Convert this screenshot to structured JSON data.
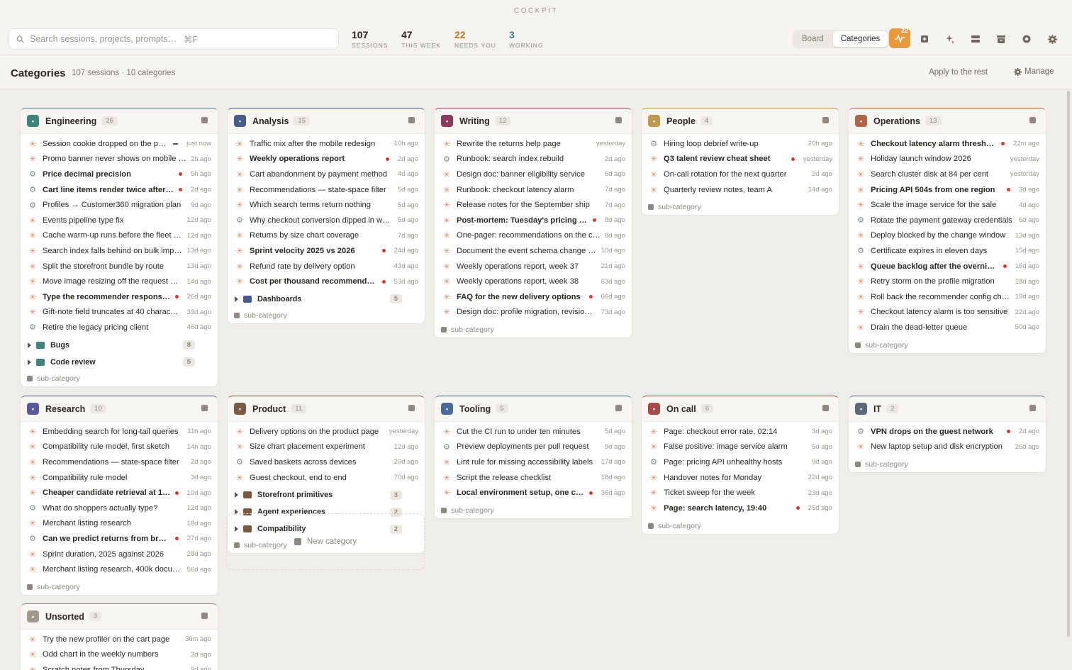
{
  "app": {
    "name": "COCKPIT"
  },
  "search": {
    "placeholder": "Search sessions, projects, prompts…",
    "shortcut": "⌘F"
  },
  "stats": [
    {
      "value": "107",
      "label": "SESSIONS",
      "color": "#2a2723"
    },
    {
      "value": "47",
      "label": "THIS WEEK",
      "color": "#2a2723"
    },
    {
      "value": "22",
      "label": "NEEDS YOU",
      "color": "#b8792a"
    },
    {
      "value": "3",
      "label": "WORKING",
      "color": "#3f7a7a"
    }
  ],
  "view_toggle": {
    "board": "Board",
    "categories": "Categories",
    "active": "categories"
  },
  "activity_badge": "22",
  "header": {
    "title": "Categories",
    "summary": "107 sessions · 10 categories",
    "apply": "Apply to the rest",
    "manage": "Manage"
  },
  "add_subcategory": "sub-category",
  "new_category": "New category",
  "categories": [
    {
      "name": "Engineering",
      "count": "26",
      "accent": "#3f7a7a",
      "icon_color": "#3f8577",
      "items": [
        {
          "title": "Session cookie dropped on the pa…",
          "time": "just now",
          "bold": false,
          "dot": false,
          "working": true,
          "icon": "spark"
        },
        {
          "title": "Promo banner never shows on mobile …",
          "time": "2h ago",
          "bold": false,
          "dot": false,
          "icon": "spark"
        },
        {
          "title": "Price decimal precision",
          "time": "5h ago",
          "bold": true,
          "dot": true,
          "icon": "gear"
        },
        {
          "title": "Cart line items render twice after r…",
          "time": "2d ago",
          "bold": true,
          "dot": true,
          "icon": "gear"
        },
        {
          "title": "Profiles → Customer360 migration plan",
          "time": "9d ago",
          "bold": false,
          "dot": false,
          "icon": "gear"
        },
        {
          "title": "Events pipeline type fix",
          "time": "12d ago",
          "bold": false,
          "dot": false,
          "icon": "spark"
        },
        {
          "title": "Cache warm-up runs before the fleet …",
          "time": "12d ago",
          "bold": false,
          "dot": false,
          "icon": "spark"
        },
        {
          "title": "Search index falls behind on bulk imp…",
          "time": "13d ago",
          "bold": false,
          "dot": false,
          "icon": "spark"
        },
        {
          "title": "Split the storefront bundle by route",
          "time": "13d ago",
          "bold": false,
          "dot": false,
          "icon": "spark"
        },
        {
          "title": "Move image resizing off the request …",
          "time": "14d ago",
          "bold": false,
          "dot": false,
          "icon": "spark"
        },
        {
          "title": "Type the recommender response …",
          "time": "26d ago",
          "bold": true,
          "dot": true,
          "icon": "spark"
        },
        {
          "title": "Gift-note field truncates at 40 charac…",
          "time": "33d ago",
          "bold": false,
          "dot": false,
          "icon": "spark"
        },
        {
          "title": "Retire the legacy pricing client",
          "time": "46d ago",
          "bold": false,
          "dot": false,
          "icon": "gear"
        }
      ],
      "subs": [
        {
          "name": "Bugs",
          "count": "8",
          "color": "#3f8577"
        },
        {
          "name": "Code review",
          "count": "5",
          "color": "#3f8577"
        }
      ]
    },
    {
      "name": "Analysis",
      "count": "15",
      "accent": "#3b4a7a",
      "icon_color": "#4a5a8a",
      "items": [
        {
          "title": "Traffic mix after the mobile redesign",
          "time": "10h ago",
          "bold": false,
          "dot": false,
          "icon": "spark"
        },
        {
          "title": "Weekly operations report",
          "time": "2d ago",
          "bold": true,
          "dot": true,
          "icon": "spark"
        },
        {
          "title": "Cart abandonment by payment method",
          "time": "4d ago",
          "bold": false,
          "dot": false,
          "icon": "spark"
        },
        {
          "title": "Recommendations — state-space filter",
          "time": "5d ago",
          "bold": false,
          "dot": false,
          "icon": "spark"
        },
        {
          "title": "Which search terms return nothing",
          "time": "5d ago",
          "bold": false,
          "dot": false,
          "icon": "spark"
        },
        {
          "title": "Why checkout conversion dipped in w…",
          "time": "5d ago",
          "bold": false,
          "dot": false,
          "icon": "gear"
        },
        {
          "title": "Returns by size chart coverage",
          "time": "7d ago",
          "bold": false,
          "dot": false,
          "icon": "spark"
        },
        {
          "title": "Sprint velocity 2025 vs 2026",
          "time": "24d ago",
          "bold": true,
          "dot": true,
          "icon": "spark"
        },
        {
          "title": "Refund rate by delivery option",
          "time": "43d ago",
          "bold": false,
          "dot": false,
          "icon": "spark"
        },
        {
          "title": "Cost per thousand recommendati…",
          "time": "53d ago",
          "bold": true,
          "dot": true,
          "icon": "spark"
        }
      ],
      "subs": [
        {
          "name": "Dashboards",
          "count": "5",
          "color": "#4a5a8a"
        }
      ]
    },
    {
      "name": "Writing",
      "count": "12",
      "accent": "#8a3a5a",
      "icon_color": "#8a3a5a",
      "items": [
        {
          "title": "Rewrite the returns help page",
          "time": "yesterday",
          "bold": false,
          "dot": false,
          "icon": "spark"
        },
        {
          "title": "Runbook: search index rebuild",
          "time": "2d ago",
          "bold": false,
          "dot": false,
          "icon": "gear"
        },
        {
          "title": "Design doc: banner eligibility service",
          "time": "6d ago",
          "bold": false,
          "dot": false,
          "icon": "spark"
        },
        {
          "title": "Runbook: checkout latency alarm",
          "time": "7d ago",
          "bold": false,
          "dot": false,
          "icon": "spark"
        },
        {
          "title": "Release notes for the September ship",
          "time": "7d ago",
          "bold": false,
          "dot": false,
          "icon": "spark"
        },
        {
          "title": "Post-mortem: Tuesday's pricing o…",
          "time": "8d ago",
          "bold": true,
          "dot": true,
          "icon": "spark"
        },
        {
          "title": "One-pager: recommendations on the c…",
          "time": "8d ago",
          "bold": false,
          "dot": false,
          "icon": "spark"
        },
        {
          "title": "Document the event schema change …",
          "time": "10d ago",
          "bold": false,
          "dot": false,
          "icon": "spark"
        },
        {
          "title": "Weekly operations report, week 37",
          "time": "21d ago",
          "bold": false,
          "dot": false,
          "icon": "spark"
        },
        {
          "title": "Weekly operations report, week 38",
          "time": "63d ago",
          "bold": false,
          "dot": false,
          "icon": "spark"
        },
        {
          "title": "FAQ for the new delivery options",
          "time": "66d ago",
          "bold": true,
          "dot": true,
          "icon": "spark"
        },
        {
          "title": "Design doc: profile migration, revisio…",
          "time": "73d ago",
          "bold": false,
          "dot": false,
          "icon": "spark"
        }
      ],
      "subs": []
    },
    {
      "name": "People",
      "count": "4",
      "accent": "#b8923a",
      "icon_color": "#c09a4a",
      "items": [
        {
          "title": "Hiring loop debrief write-up",
          "time": "20h ago",
          "bold": false,
          "dot": false,
          "icon": "gear"
        },
        {
          "title": "Q3 talent review cheat sheet",
          "time": "yesterday",
          "bold": true,
          "dot": true,
          "icon": "spark"
        },
        {
          "title": "On-call rotation for the next quarter",
          "time": "2d ago",
          "bold": false,
          "dot": false,
          "icon": "spark"
        },
        {
          "title": "Quarterly review notes, team A",
          "time": "14d ago",
          "bold": false,
          "dot": false,
          "icon": "spark"
        }
      ],
      "subs": []
    },
    {
      "name": "Operations",
      "count": "13",
      "accent": "#a85a3a",
      "icon_color": "#b0654a",
      "items": [
        {
          "title": "Checkout latency alarm threshold",
          "time": "22m ago",
          "bold": true,
          "dot": true,
          "icon": "spark"
        },
        {
          "title": "Holiday launch window 2026",
          "time": "yesterday",
          "bold": false,
          "dot": false,
          "icon": "spark"
        },
        {
          "title": "Search cluster disk at 84 per cent",
          "time": "yesterday",
          "bold": false,
          "dot": false,
          "icon": "spark"
        },
        {
          "title": "Pricing API 504s from one region",
          "time": "3d ago",
          "bold": true,
          "dot": true,
          "icon": "spark"
        },
        {
          "title": "Scale the image service for the sale",
          "time": "4d ago",
          "bold": false,
          "dot": false,
          "icon": "spark"
        },
        {
          "title": "Rotate the payment gateway credentials",
          "time": "6d ago",
          "bold": false,
          "dot": false,
          "icon": "gear"
        },
        {
          "title": "Deploy blocked by the change window",
          "time": "13d ago",
          "bold": false,
          "dot": false,
          "icon": "spark"
        },
        {
          "title": "Certificate expires in eleven days",
          "time": "15d ago",
          "bold": false,
          "dot": false,
          "icon": "gear"
        },
        {
          "title": "Queue backlog after the overnigh…",
          "time": "16d ago",
          "bold": true,
          "dot": true,
          "icon": "spark"
        },
        {
          "title": "Retry storm on the profile migration",
          "time": "18d ago",
          "bold": false,
          "dot": false,
          "icon": "spark"
        },
        {
          "title": "Roll back the recommender config ch…",
          "time": "19d ago",
          "bold": false,
          "dot": false,
          "icon": "spark"
        },
        {
          "title": "Checkout latency alarm is too sensitive",
          "time": "22d ago",
          "bold": false,
          "dot": false,
          "icon": "spark"
        },
        {
          "title": "Drain the dead-letter queue",
          "time": "50d ago",
          "bold": false,
          "dot": false,
          "icon": "spark"
        }
      ],
      "subs": []
    },
    {
      "name": "Research",
      "count": "10",
      "accent": "#4a4a8a",
      "icon_color": "#5a5a9a",
      "items": [
        {
          "title": "Embedding search for long-tail queries",
          "time": "11h ago",
          "bold": false,
          "dot": false,
          "icon": "spark"
        },
        {
          "title": "Compatibility rule model, first sketch",
          "time": "14h ago",
          "bold": false,
          "dot": false,
          "icon": "spark"
        },
        {
          "title": "Recommendations — state-space filter",
          "time": "2d ago",
          "bold": false,
          "dot": false,
          "icon": "spark"
        },
        {
          "title": "Compatibility rule model",
          "time": "3d ago",
          "bold": false,
          "dot": false,
          "icon": "spark"
        },
        {
          "title": "Cheaper candidate retrieval at 16…",
          "time": "10d ago",
          "bold": true,
          "dot": true,
          "icon": "spark"
        },
        {
          "title": "What do shoppers actually type?",
          "time": "12d ago",
          "bold": false,
          "dot": false,
          "icon": "gear"
        },
        {
          "title": "Merchant listing research",
          "time": "18d ago",
          "bold": false,
          "dot": false,
          "icon": "spark"
        },
        {
          "title": "Can we predict returns from brow…",
          "time": "27d ago",
          "bold": true,
          "dot": true,
          "icon": "gear"
        },
        {
          "title": "Sprint duration, 2025 against 2026",
          "time": "28d ago",
          "bold": false,
          "dot": false,
          "icon": "spark"
        },
        {
          "title": "Merchant listing research, 400k docu…",
          "time": "56d ago",
          "bold": false,
          "dot": false,
          "icon": "spark"
        }
      ],
      "subs": []
    },
    {
      "name": "Product",
      "count": "11",
      "accent": "#6a5040",
      "icon_color": "#7a5a45",
      "items": [
        {
          "title": "Delivery options on the product page",
          "time": "yesterday",
          "bold": false,
          "dot": false,
          "icon": "spark"
        },
        {
          "title": "Size chart placement experiment",
          "time": "12d ago",
          "bold": false,
          "dot": false,
          "icon": "spark"
        },
        {
          "title": "Saved baskets across devices",
          "time": "29d ago",
          "bold": false,
          "dot": false,
          "icon": "gear"
        },
        {
          "title": "Guest checkout, end to end",
          "time": "70d ago",
          "bold": false,
          "dot": false,
          "icon": "spark"
        }
      ],
      "subs": [
        {
          "name": "Storefront primitives",
          "count": "3",
          "color": "#7a5a45"
        },
        {
          "name": "Agent experiences",
          "count": "2",
          "color": "#7a5a45"
        },
        {
          "name": "Compatibility",
          "count": "2",
          "color": "#7a5a45"
        }
      ]
    },
    {
      "name": "Tooling",
      "count": "5",
      "accent": "#3a5a8a",
      "icon_color": "#4a6a9a",
      "items": [
        {
          "title": "Cut the CI run to under ten minutes",
          "time": "5d ago",
          "bold": false,
          "dot": false,
          "icon": "spark"
        },
        {
          "title": "Preview deployments per pull request",
          "time": "9d ago",
          "bold": false,
          "dot": false,
          "icon": "gear"
        },
        {
          "title": "Lint rule for missing accessibility labels",
          "time": "17d ago",
          "bold": false,
          "dot": false,
          "icon": "spark"
        },
        {
          "title": "Script the release checklist",
          "time": "18d ago",
          "bold": false,
          "dot": false,
          "icon": "spark"
        },
        {
          "title": "Local environment setup, one co…",
          "time": "36d ago",
          "bold": true,
          "dot": true,
          "icon": "spark"
        }
      ],
      "subs": []
    },
    {
      "name": "On call",
      "count": "6",
      "accent": "#9a3a3a",
      "icon_color": "#a84a4a",
      "items": [
        {
          "title": "Page: checkout error rate, 02:14",
          "time": "3d ago",
          "bold": false,
          "dot": false,
          "icon": "spark"
        },
        {
          "title": "False positive: image service alarm",
          "time": "5d ago",
          "bold": false,
          "dot": false,
          "icon": "spark"
        },
        {
          "title": "Page: pricing API unhealthy hosts",
          "time": "9d ago",
          "bold": false,
          "dot": false,
          "icon": "gear"
        },
        {
          "title": "Handover notes for Monday",
          "time": "22d ago",
          "bold": false,
          "dot": false,
          "icon": "spark"
        },
        {
          "title": "Ticket sweep for the week",
          "time": "23d ago",
          "bold": false,
          "dot": false,
          "icon": "spark"
        },
        {
          "title": "Page: search latency, 19:40",
          "time": "25d ago",
          "bold": true,
          "dot": true,
          "icon": "spark"
        }
      ],
      "subs": []
    },
    {
      "name": "IT",
      "count": "2",
      "accent": "#4a5a6a",
      "icon_color": "#5a6a7a",
      "items": [
        {
          "title": "VPN drops on the guest network",
          "time": "2d ago",
          "bold": true,
          "dot": true,
          "icon": "gear"
        },
        {
          "title": "New laptop setup and disk encryption",
          "time": "26d ago",
          "bold": false,
          "dot": false,
          "icon": "spark"
        }
      ],
      "subs": []
    },
    {
      "name": "Unsorted",
      "count": "3",
      "accent": "#8d8881",
      "icon_color": "#a09a90",
      "items": [
        {
          "title": "Try the new profiler on the cart page",
          "time": "36m ago",
          "bold": false,
          "dot": false,
          "icon": "spark"
        },
        {
          "title": "Odd chart in the weekly numbers",
          "time": "3d ago",
          "bold": false,
          "dot": false,
          "icon": "spark"
        },
        {
          "title": "Scratch notes from Thursday",
          "time": "9d ago",
          "bold": false,
          "dot": false,
          "icon": "spark"
        }
      ],
      "subs": []
    }
  ]
}
